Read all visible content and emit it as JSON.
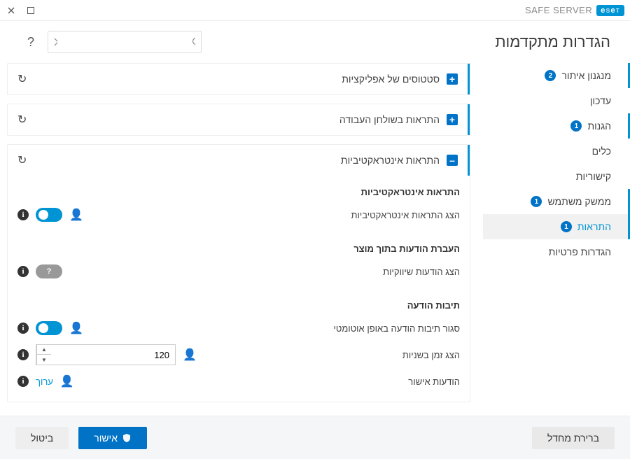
{
  "window": {
    "brand_product": "SAFE SERVER",
    "page_title": "הגדרות מתקדמות"
  },
  "search": {
    "placeholder": ""
  },
  "sidebar": {
    "items": [
      {
        "label": "מנגנון איתור",
        "badge": "2"
      },
      {
        "label": "עדכון",
        "badge": null
      },
      {
        "label": "הגנות",
        "badge": "1"
      },
      {
        "label": "כלים",
        "badge": null
      },
      {
        "label": "קישוריות",
        "badge": null
      },
      {
        "label": "ממשק משתמש",
        "badge": "1"
      },
      {
        "label": "התראות",
        "badge": "1"
      },
      {
        "label": "הגדרות פרטיות",
        "badge": null
      }
    ]
  },
  "panels": {
    "app_statuses": {
      "title": "סטטוסים של אפליקציות"
    },
    "desktop_notifications": {
      "title": "התראות בשולחן העבודה"
    },
    "interactive": {
      "title": "התראות אינטראקטיביות",
      "sections": {
        "interactive_notif": {
          "title": "התראות אינטראקטיביות",
          "show_label": "הצג התראות אינטראקטיביות"
        },
        "in_product": {
          "title": "העברת הודעות בתוך מוצר",
          "marketing_label": "הצג הודעות שיווקיות"
        },
        "msgboxes": {
          "title": "תיבות הודעה",
          "autoclose_label": "סגור תיבות הודעה באופן אוטומטי",
          "timeout_label": "הצג זמן בשניות",
          "timeout_value": "120",
          "confirm_label": "הודעות אישור",
          "edit_link": "ערוך"
        }
      }
    }
  },
  "footer": {
    "default": "ברירת מחדל",
    "ok": "אישור",
    "cancel": "ביטול"
  },
  "chart_data": null
}
